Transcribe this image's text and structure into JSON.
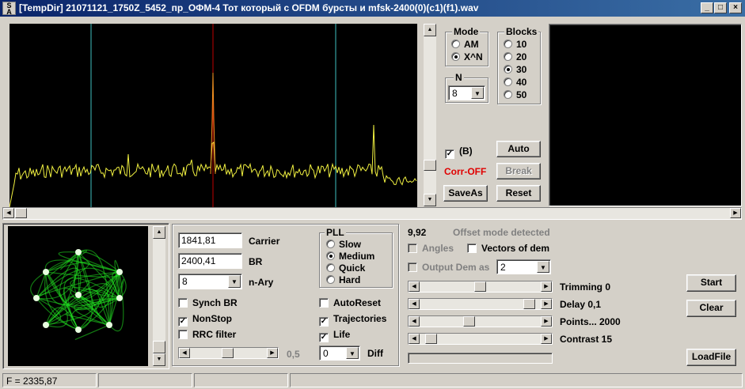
{
  "window": {
    "title": "[TempDir] 21071121_1750Z_5452_пр_ОФМ-4 Тот который с OFDM бурсты и mfsk-2400(0)(c1)(f1).wav",
    "icon_text_top": "S",
    "icon_text_bottom": "A",
    "minimize": "_",
    "maximize": "□",
    "close": "×"
  },
  "mode": {
    "label": "Mode",
    "options": [
      "AM",
      "X^N"
    ],
    "selected": "X^N"
  },
  "blocks": {
    "label": "Blocks",
    "options": [
      "10",
      "20",
      "30",
      "40",
      "50"
    ],
    "selected": "30"
  },
  "n_group": {
    "label": "N",
    "value": "8"
  },
  "b_check": {
    "label": "(B)",
    "checked": true
  },
  "corr_status": {
    "text": "Corr-OFF",
    "color": "#e00000"
  },
  "buttons": {
    "auto": "Auto",
    "break": "Break",
    "saveas": "SaveAs",
    "reset": "Reset",
    "start": "Start",
    "clear": "Clear",
    "loadfile": "LoadFile"
  },
  "demod": {
    "carrier_value": "1841,81",
    "carrier_label": "Carrier",
    "br_value": "2400,41",
    "br_label": "BR",
    "nary_value": "8",
    "nary_label": "n-Ary",
    "synch_br": {
      "label": "Synch BR",
      "checked": false
    },
    "nonstop": {
      "label": "NonStop",
      "checked": true
    },
    "rrc_filter": {
      "label": "RRC filter",
      "checked": false
    },
    "slider_value": "0,5",
    "diff_value": "0",
    "diff_label": "Diff"
  },
  "pll": {
    "label": "PLL",
    "options": [
      "Slow",
      "Medium",
      "Quick",
      "Hard"
    ],
    "selected": "Medium"
  },
  "options_checks": {
    "autoreset": {
      "label": "AutoReset",
      "checked": false
    },
    "trajectories": {
      "label": "Trajectories",
      "checked": true
    },
    "life": {
      "label": "Life",
      "checked": true
    }
  },
  "right_panel": {
    "offset_value": "9,92",
    "offset_text": "Offset mode detected",
    "angles": {
      "label": "Angles",
      "checked": false
    },
    "vectors_of_dem": {
      "label": "Vectors of dem",
      "checked": false
    },
    "output_dem_as": {
      "label": "Output Dem as",
      "checked": false
    },
    "output_value": "2",
    "trimming": "Trimming 0",
    "delay": "Delay  0,1",
    "points": "Points... 2000",
    "contrast": "Contrast 15",
    "trimming_level": 0.5,
    "delay_level": 0.95,
    "points_level": 0.4,
    "contrast_level": 0.05
  },
  "status_bar": {
    "frequency": "F = 2335,87"
  },
  "colors": {
    "spectrum_line": "#f0f040",
    "marker_cyan": "#40c0c0",
    "marker_red": "#c00000",
    "constellation": "#20e020"
  }
}
